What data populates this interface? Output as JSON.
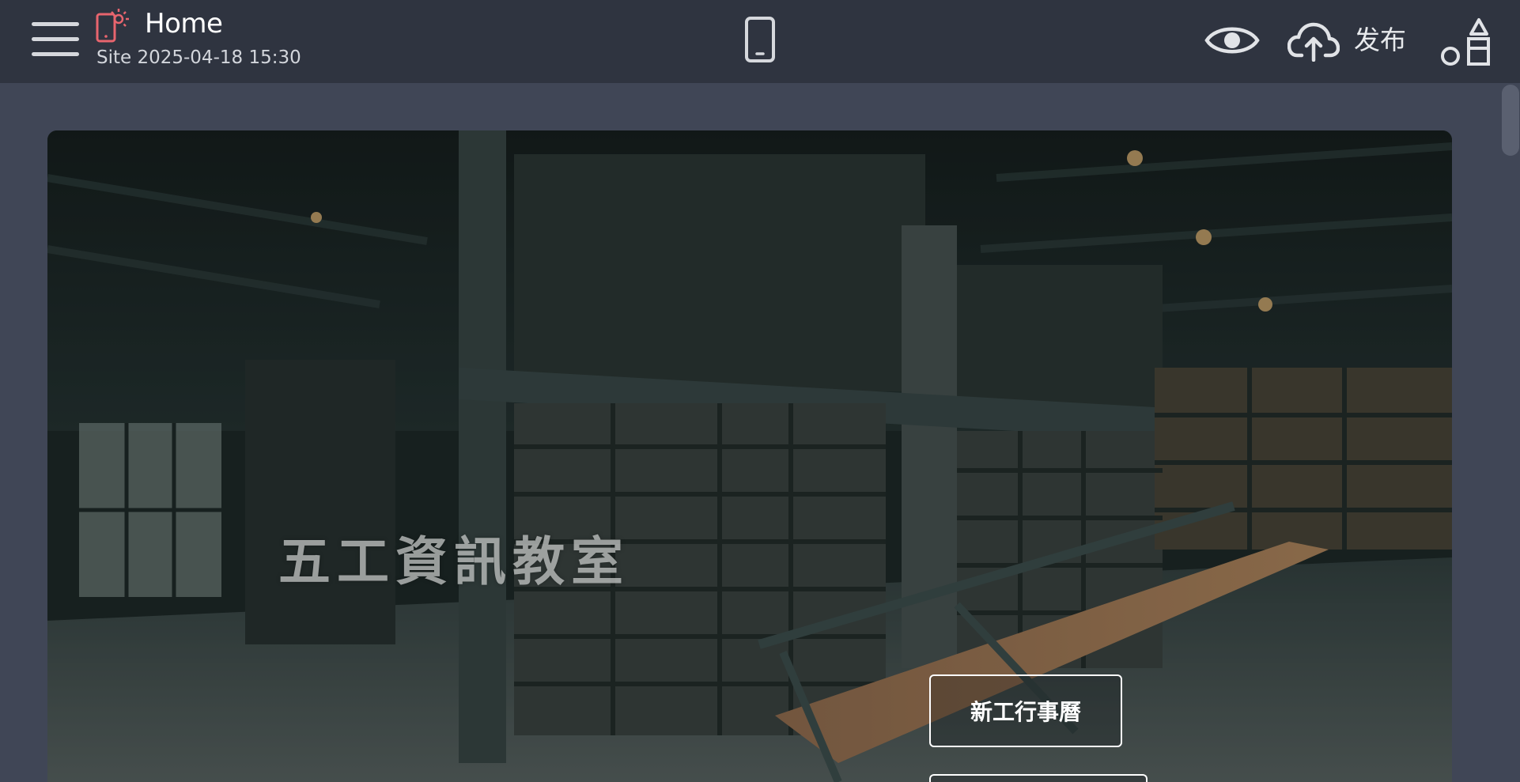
{
  "header": {
    "page_title": "Home",
    "subtitle": "Site 2025-04-18 15:30",
    "publish_label": "发布",
    "icons": {
      "menu": "hamburger-menu-icon",
      "page": "mobile-page-icon",
      "device": "mobile-device-icon",
      "preview": "eye-icon",
      "publish": "cloud-upload-icon",
      "widgets": "shapes-icon"
    },
    "accent_color": "#e8656e"
  },
  "hero": {
    "title": "五工資訊教室",
    "buttons": [
      {
        "label": "新工行事曆"
      },
      {
        "label": ""
      }
    ]
  }
}
